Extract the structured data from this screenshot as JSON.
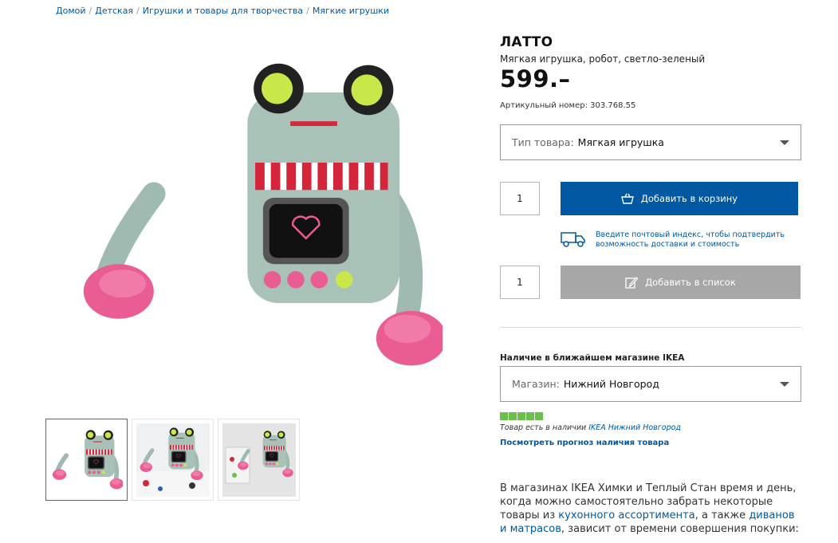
{
  "breadcrumb": [
    "Домой",
    "Детская",
    "Игрушки и товары для творчества",
    "Мягкие игрушки"
  ],
  "product": {
    "name": "ЛАТТО",
    "description": "Мягкая игрушка, робот, светло-зеленый",
    "price": "599.–",
    "article": "Артикульный номер: 303.768.55"
  },
  "type_select": {
    "label": "Тип товара:",
    "value": "Мягкая игрушка"
  },
  "cart": {
    "qty": "1",
    "button_label": "Добавить в корзину"
  },
  "delivery": {
    "text": "Введите почтовый индекс, чтобы подтвердить возможность доставки и стоимость"
  },
  "list": {
    "qty": "1",
    "button_label": "Добавить в список"
  },
  "availability": {
    "title": "Наличие в ближайшем магазине IKEA",
    "store_label": "Магазин:",
    "store_value": "Нижний Новгород",
    "stock_level": 1.0,
    "stock_prefix": "Товар есть в наличии",
    "stock_store": "IKEA Нижний Новгород",
    "forecast_link": "Посмотреть прогноз наличия товара"
  },
  "info": {
    "p1": "В магазинах IKEA Химки и Теплый Стан время и день, когда можно самостоятельно забрать некоторые товары из ",
    "link1": "кухонного ассортимента",
    "p2": ", а также ",
    "link2": "диванов и матрасов",
    "p3": ", зависит от времени совершения покупки:"
  },
  "colors": {
    "accent_blue": "#0058a3",
    "button_grey": "#a7a7a7",
    "stock_green": "#6bc04b"
  }
}
